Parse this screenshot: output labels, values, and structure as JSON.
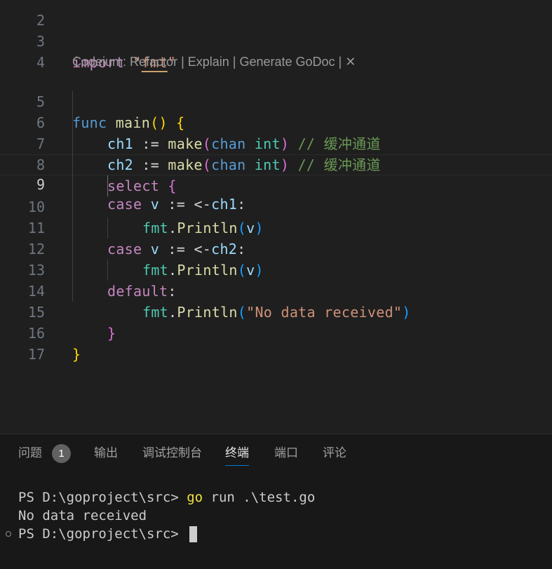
{
  "editor": {
    "partial_line_number": "2",
    "codelens": "Codeium: Refactor | Explain | Generate GoDoc | ✕",
    "lines": [
      {
        "n": "3"
      },
      {
        "n": "4"
      },
      {
        "n": "5"
      },
      {
        "n": "6"
      },
      {
        "n": "7"
      },
      {
        "n": "8"
      },
      {
        "n": "9"
      },
      {
        "n": "10"
      },
      {
        "n": "11"
      },
      {
        "n": "12"
      },
      {
        "n": "13"
      },
      {
        "n": "14"
      },
      {
        "n": "15"
      },
      {
        "n": "16"
      },
      {
        "n": "17"
      }
    ],
    "tokens": {
      "import": "import",
      "fmt_quoted_open": "\"",
      "fmt_pkg": "fmt",
      "fmt_quoted_close": "\"",
      "func": "func",
      "main": "main",
      "paren_open": "(",
      "paren_close": ")",
      "brace_open": "{",
      "brace_close": "}",
      "ch1": "ch1",
      "ch2": "ch2",
      "assign": ":=",
      "make": "make",
      "chan": "chan",
      "int": "int",
      "comment": "// 缓冲通道",
      "select": "select",
      "case": "case",
      "v": "v",
      "recv": "<-",
      "colon": ":",
      "fmt": "fmt",
      "dot": ".",
      "println": "Println",
      "default": "default",
      "str_no_data": "\"No data received\""
    },
    "active_line": "9"
  },
  "panel": {
    "tabs": [
      {
        "label": "问题"
      },
      {
        "label": "输出"
      },
      {
        "label": "调试控制台"
      },
      {
        "label": "终端"
      },
      {
        "label": "端口"
      },
      {
        "label": "评论"
      }
    ],
    "problems_count": "1",
    "active_tab": "终端",
    "terminal": {
      "line1_prompt": "PS D:\\goproject\\src> ",
      "line1_cmd": "go",
      "line1_args": " run .\\test.go",
      "line2": "No data received",
      "line3_prompt": "PS D:\\goproject\\src> "
    }
  }
}
